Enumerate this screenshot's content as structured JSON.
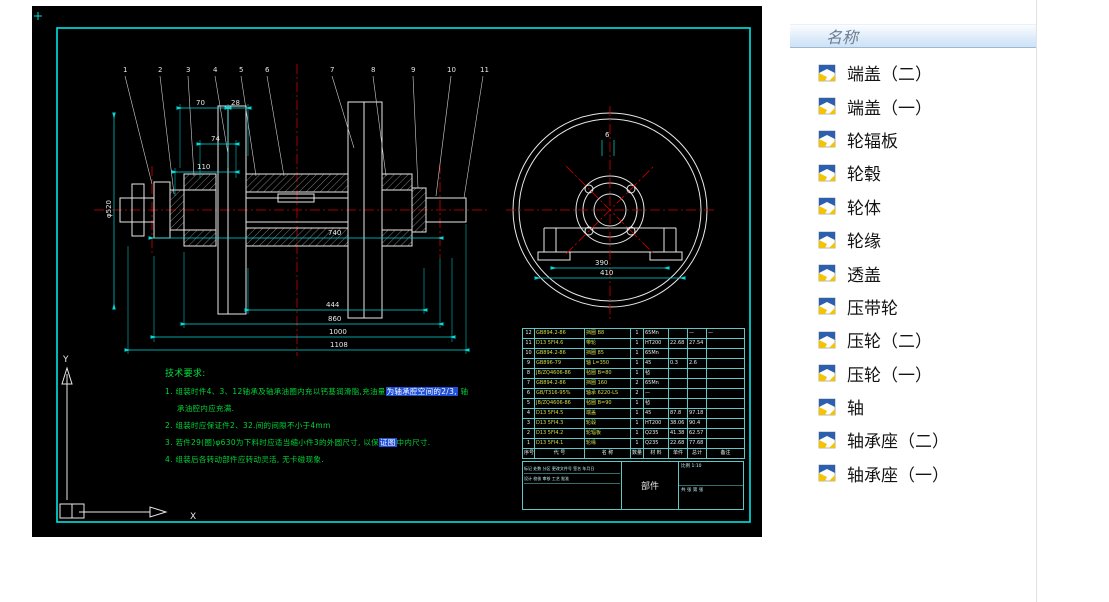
{
  "cad": {
    "balloons": [
      "1",
      "2",
      "3",
      "4",
      "5",
      "6",
      "7",
      "8",
      "9",
      "10",
      "11"
    ],
    "dims": {
      "top_70": "70",
      "top_28": "28",
      "mid_74": "74",
      "mid_110": "110",
      "len_740": "740",
      "chain_444": "444",
      "chain_860": "860",
      "chain_1000": "1000",
      "chain_1108": "1108",
      "dia_left": "φ520"
    },
    "circle": {
      "top_6": "6",
      "base_390": "390",
      "base_410": "410"
    },
    "ucs": {
      "x_label": "X",
      "y_label": "Y"
    },
    "notes": {
      "title": "技术要求:",
      "l1a": "1. 组装时件4、3、12轴承及轴承油圈内充以钙基润滑脂,充油量",
      "l1b": "为轴承腔空间的2/3,",
      "l1c": " 轴",
      "l2": "承油腔内应充满.",
      "l3": "2. 组装时应保证件2、32.间的间隙不小于4mm",
      "l4a": "3. 若件29(圈)φ630为下料时应适当缩小件3的外圆尺寸, 以保",
      "l4b": "证图",
      "l4c": "中内尺寸.",
      "l5": "4. 组装后各转动部件应转动灵活, 无卡碰现象."
    },
    "bom": {
      "rows": [
        [
          "12",
          "GB894.2-86",
          "挡圈 B8",
          "1",
          "65Mn",
          "",
          "—",
          "—"
        ],
        [
          "11",
          "D13 5FI4.6",
          "带轮",
          "1",
          "HT200",
          "22.68",
          "27.54",
          ""
        ],
        [
          "10",
          "GB894.2-86",
          "挡圈 85",
          "1",
          "65Mn",
          "",
          "",
          ""
        ],
        [
          "9",
          "GB896-79",
          "轴 L=350",
          "1",
          "45",
          "0.3",
          "2.6",
          ""
        ],
        [
          "8",
          "JB/ZQ4606-86",
          "毡圈 B=80",
          "1",
          "毡",
          "",
          "",
          ""
        ],
        [
          "7",
          "GB894.2-86",
          "挡圈 160",
          "2",
          "65Mn",
          "",
          "",
          ""
        ],
        [
          "6",
          "GB/T316-95%",
          "轴承 6220-LS",
          "2",
          "—",
          "",
          "",
          ""
        ],
        [
          "5",
          "JB/ZQ4606-86",
          "毡圈 B=90",
          "1",
          "毡",
          "",
          "",
          ""
        ],
        [
          "4",
          "D13 5FI4.5",
          "端盖",
          "1",
          "45",
          "87.8",
          "97.18",
          ""
        ],
        [
          "3",
          "D13 5FI4.3",
          "轮毂",
          "1",
          "HT200",
          "38.06",
          "90.4",
          ""
        ],
        [
          "2",
          "D13 5FI4.2",
          "轮辐板",
          "1",
          "Q235",
          "41.38",
          "62.57",
          ""
        ],
        [
          "1",
          "D13 5FI4.1",
          "轮缘",
          "1",
          "Q235",
          "22.68",
          "77.68",
          ""
        ]
      ],
      "header": [
        "序号",
        "代 号",
        "名 称",
        "数量",
        "材 料",
        "单件",
        "总计",
        "备注"
      ]
    },
    "title_block": {
      "part_label": "部件",
      "scale_label": "比例",
      "scale": "1:10",
      "row1": "标记 处数 分区 更改文件号 签名 年月日",
      "row2": "设计  校核  审核  工艺  批准",
      "sheet": "共 张 第 张"
    }
  },
  "panel": {
    "header": "名称",
    "files": [
      {
        "name": "端盖（二）"
      },
      {
        "name": "端盖（一）"
      },
      {
        "name": "轮辐板"
      },
      {
        "name": "轮毂"
      },
      {
        "name": "轮体"
      },
      {
        "name": "轮缘"
      },
      {
        "name": "透盖"
      },
      {
        "name": "压带轮"
      },
      {
        "name": "压轮（二）"
      },
      {
        "name": "压轮（一）"
      },
      {
        "name": "轴"
      },
      {
        "name": "轴承座（二）"
      },
      {
        "name": "轴承座（一）"
      }
    ]
  }
}
